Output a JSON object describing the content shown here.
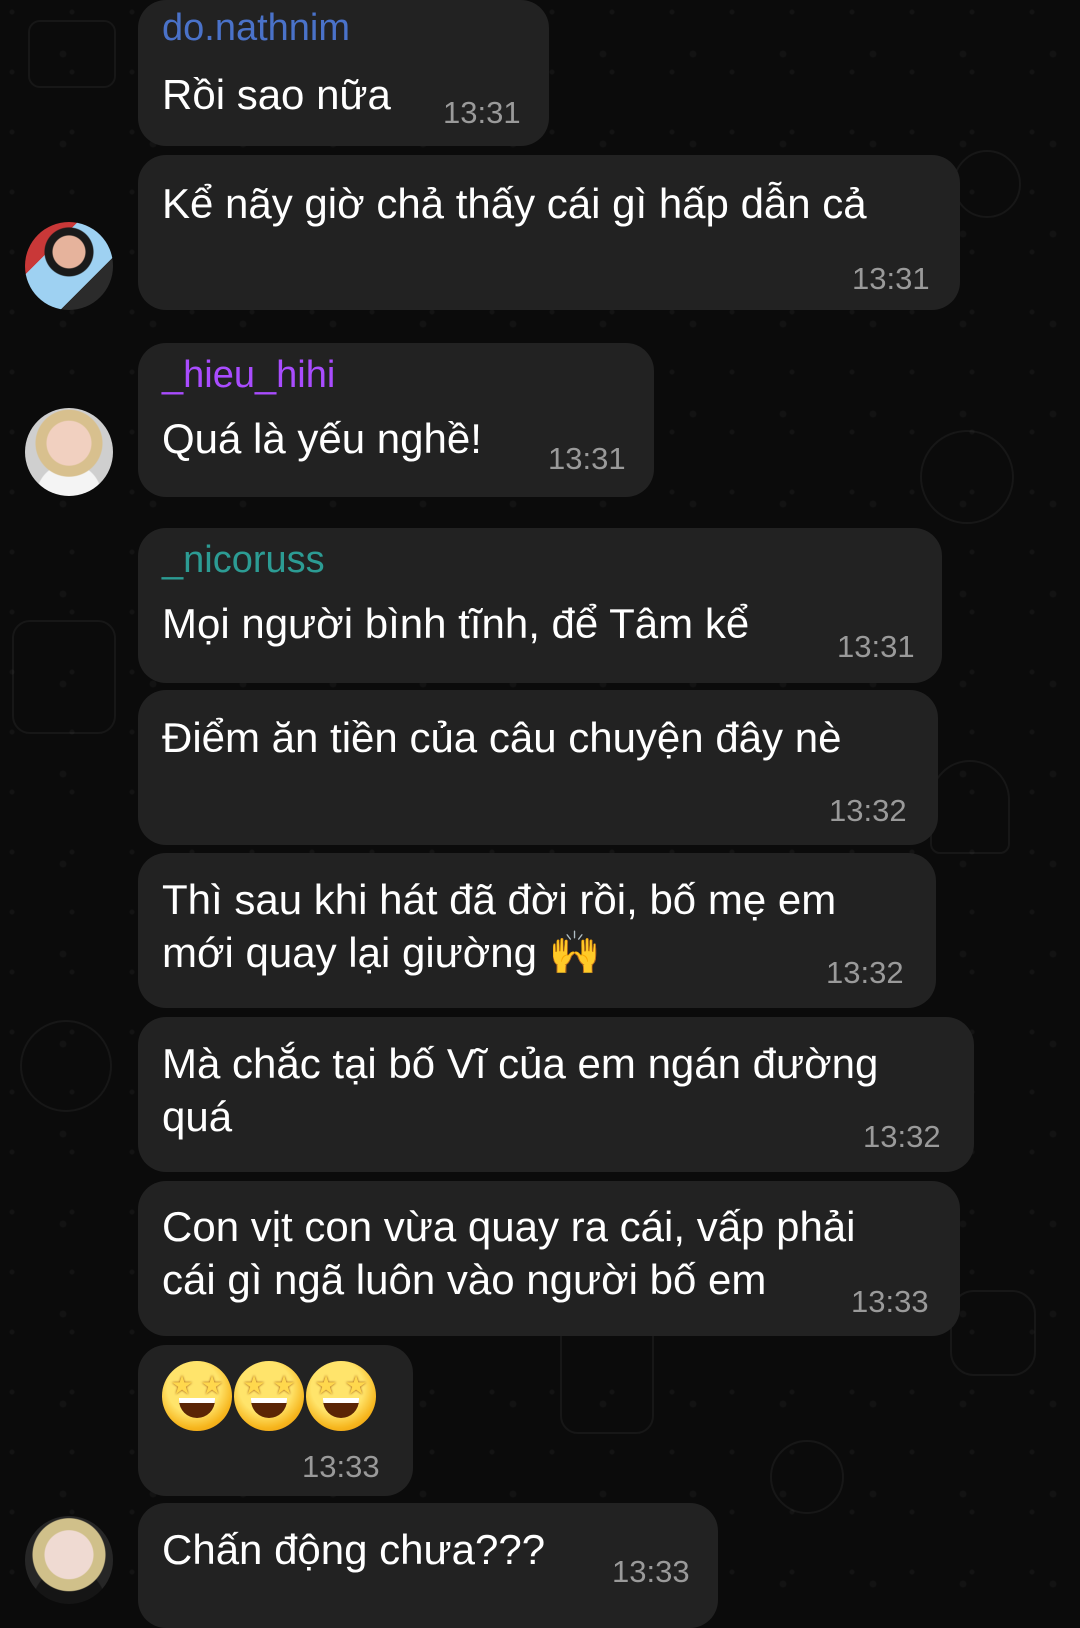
{
  "colors": {
    "background": "#0b0b0b",
    "bubble": "#222222",
    "name_do_nathnim": "#4a72c9",
    "name_hieu_hihi": "#a94cff",
    "name_nicoruss": "#2c9c94",
    "time": "#9a9a9a"
  },
  "messages": [
    {
      "sender": "do.nathnim",
      "text": "Rồi sao nữa",
      "time": "13:31"
    },
    {
      "text": "Kể nãy giờ chả thấy cái gì hấp dẫn cả",
      "time": "13:31"
    },
    {
      "sender": "_hieu_hihi",
      "text": "Quá là yếu nghề!",
      "time": "13:31"
    },
    {
      "sender": "_nicoruss",
      "text": "Mọi người bình tĩnh, để Tâm kể",
      "time": "13:31"
    },
    {
      "text": "Điểm ăn tiền của câu chuyện đây nè",
      "time": "13:32"
    },
    {
      "text_line1": "Thì sau khi hát đã đời rồi, bố mẹ em",
      "text_line2": "mới quay lại giường 🙌",
      "time": "13:32"
    },
    {
      "text_line1": "Mà chắc tại bố Vĩ của em ngán đường",
      "text_line2": "quá",
      "time": "13:32"
    },
    {
      "text_line1": "Con vịt con vừa quay ra cái, vấp phải",
      "text_line2": "cái gì ngã luôn vào người bố em",
      "time": "13:33"
    },
    {
      "emoji_icons": [
        "star-struck-icon",
        "star-struck-icon",
        "star-struck-icon"
      ],
      "time": "13:33"
    },
    {
      "text": "Chấn động chưa???",
      "time": "13:33"
    }
  ],
  "avatars": [
    "avatar-user-1",
    "avatar-user-2",
    "avatar-user-3"
  ]
}
